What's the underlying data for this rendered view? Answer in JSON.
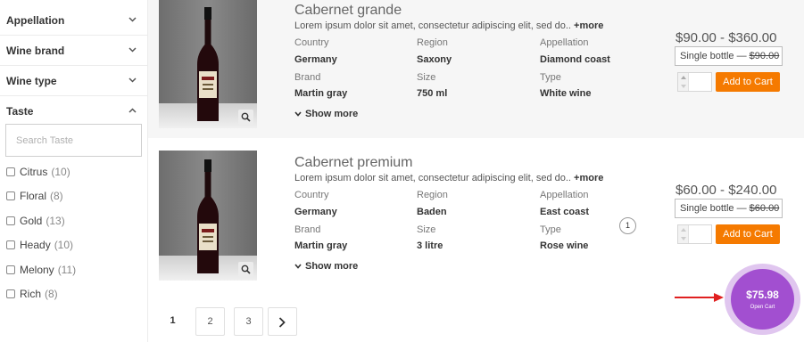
{
  "sidebar": {
    "filters": [
      {
        "label": "Appellation",
        "expanded": false
      },
      {
        "label": "Wine brand",
        "expanded": false
      },
      {
        "label": "Wine type",
        "expanded": false
      },
      {
        "label": "Taste",
        "expanded": true
      }
    ],
    "taste_search_placeholder": "Search Taste",
    "taste_options": [
      {
        "label": "Citrus",
        "count": "(10)"
      },
      {
        "label": "Floral",
        "count": "(8)"
      },
      {
        "label": "Gold",
        "count": "(13)"
      },
      {
        "label": "Heady",
        "count": "(10)"
      },
      {
        "label": "Melony",
        "count": "(11)"
      },
      {
        "label": "Rich",
        "count": "(8)"
      }
    ]
  },
  "products": [
    {
      "title": "Cabernet grande",
      "description": "Lorem ipsum dolor sit amet, consectetur adipiscing elit, sed do..",
      "more_label": "+more",
      "attributes": {
        "country_label": "Country",
        "country": "Germany",
        "region_label": "Region",
        "region": "Saxony",
        "appellation_label": "Appellation",
        "appellation": "Diamond coast",
        "brand_label": "Brand",
        "brand": "Martin gray",
        "size_label": "Size",
        "size": "750 ml",
        "type_label": "Type",
        "type": "White wine"
      },
      "show_more_label": "Show more",
      "price_range": "$90.00 - $360.00",
      "variant_prefix": "Single bottle — ",
      "variant_price": "$90.00",
      "add_to_cart_label": "Add to Cart"
    },
    {
      "title": "Cabernet premium",
      "description": "Lorem ipsum dolor sit amet, consectetur adipiscing elit, sed do..",
      "more_label": "+more",
      "attributes": {
        "country_label": "Country",
        "country": "Germany",
        "region_label": "Region",
        "region": "Baden",
        "appellation_label": "Appellation",
        "appellation": "East coast",
        "brand_label": "Brand",
        "brand": "Martin gray",
        "size_label": "Size",
        "size": "3 litre",
        "type_label": "Type",
        "type": "Rose wine"
      },
      "show_more_label": "Show more",
      "price_range": "$60.00 - $240.00",
      "variant_prefix": "Single bottle — ",
      "variant_price": "$60.00",
      "add_to_cart_label": "Add to Cart",
      "cart_qty_badge": "1"
    }
  ],
  "pagination": {
    "pages": [
      "1",
      "2",
      "3"
    ],
    "current": "1"
  },
  "cart": {
    "total": "$75.98",
    "label": "Open Cart"
  },
  "colors": {
    "accent": "#f57a00",
    "cart": "#a24fd0",
    "arrow": "#e02020"
  }
}
